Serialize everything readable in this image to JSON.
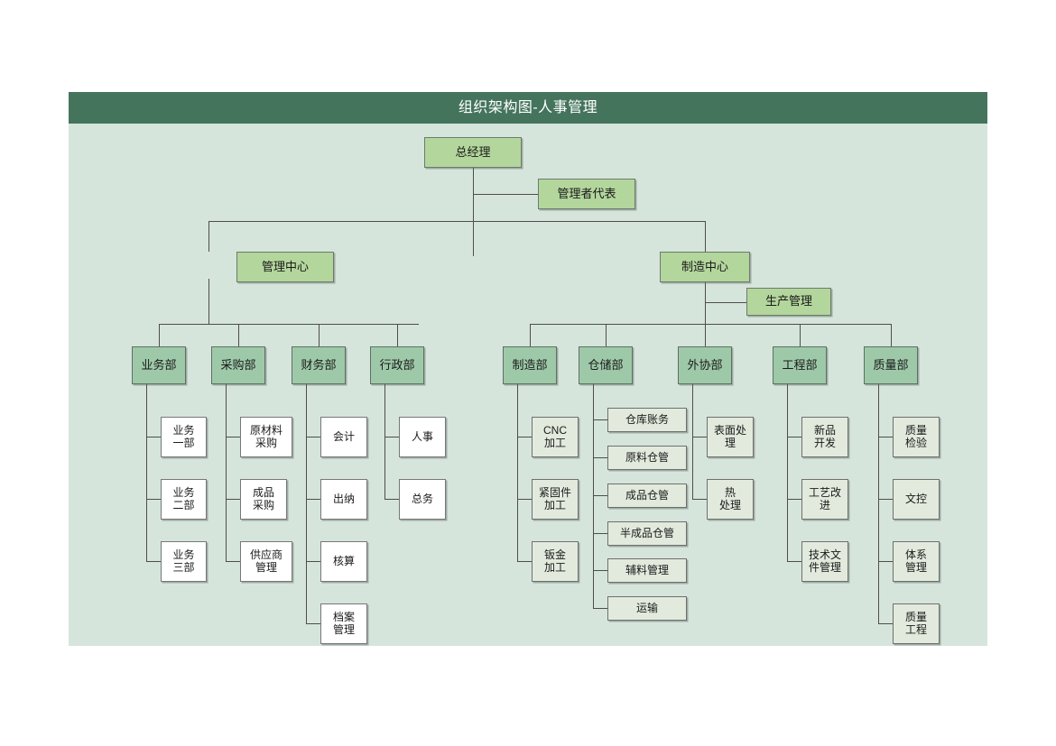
{
  "header": {
    "title": "组织架构图-人事管理",
    "bar_color": "#45745d"
  },
  "canvas": {
    "background": "#d6e5dc"
  },
  "palette": {
    "level1_fill": "#b3d69c",
    "level2_fill": "#9ec9a9",
    "leaf_fill": "#ffffff",
    "leaf_tint_fill": "#e2eadd",
    "line_color": "#4d4d4d",
    "header_fill": "#45745d",
    "text_color": "#1a1a1a",
    "header_text_color": "#ffffff"
  },
  "chart_data": {
    "type": "org-chart",
    "title": "组织架构图-人事管理",
    "root": "总经理",
    "nodes": {
      "general_manager": "总经理",
      "management_rep": "管理者代表",
      "management_center": "管理中心",
      "manufacturing_center": "制造中心",
      "production_management": "生产管理",
      "business_dept": "业务部",
      "purchasing_dept": "采购部",
      "finance_dept": "财务部",
      "admin_dept": "行政部",
      "manufacturing_dept": "制造部",
      "warehouse_dept": "仓储部",
      "outsourcing_dept": "外协部",
      "engineering_dept": "工程部",
      "quality_dept": "质量部"
    },
    "branches": [
      {
        "parent": "业务部",
        "children": [
          "业务\n一部",
          "业务\n二部",
          "业务\n三部"
        ]
      },
      {
        "parent": "采购部",
        "children": [
          "原材料\n采购",
          "成品\n采购",
          "供应商\n管理"
        ]
      },
      {
        "parent": "财务部",
        "children": [
          "会计",
          "出纳",
          "核算",
          "档案\n管理"
        ]
      },
      {
        "parent": "行政部",
        "children": [
          "人事",
          "总务"
        ]
      },
      {
        "parent": "制造部",
        "children": [
          "CNC\n加工",
          "紧固件\n加工",
          "钣金\n加工"
        ]
      },
      {
        "parent": "仓储部",
        "children": [
          "仓库账务",
          "原料仓管",
          "成品仓管",
          "半成品仓管",
          "辅料管理",
          "运输"
        ]
      },
      {
        "parent": "外协部",
        "children": [
          "表面处\n理",
          "热\n处理"
        ]
      },
      {
        "parent": "工程部",
        "children": [
          "新品\n开发",
          "工艺改\n进",
          "技术文\n件管理"
        ]
      },
      {
        "parent": "质量部",
        "children": [
          "质量\n检验",
          "文控",
          "体系\n管理",
          "质量\n工程"
        ]
      }
    ],
    "hierarchy": {
      "总经理": {
        "side": [
          "管理者代表"
        ],
        "children": {
          "管理中心": [
            "业务部",
            "采购部",
            "财务部",
            "行政部"
          ],
          "制造中心": [
            "制造部",
            "仓储部",
            "外协部",
            "工程部",
            "质量部"
          ]
        },
        "manufacturing_side": [
          "生产管理"
        ]
      }
    }
  }
}
